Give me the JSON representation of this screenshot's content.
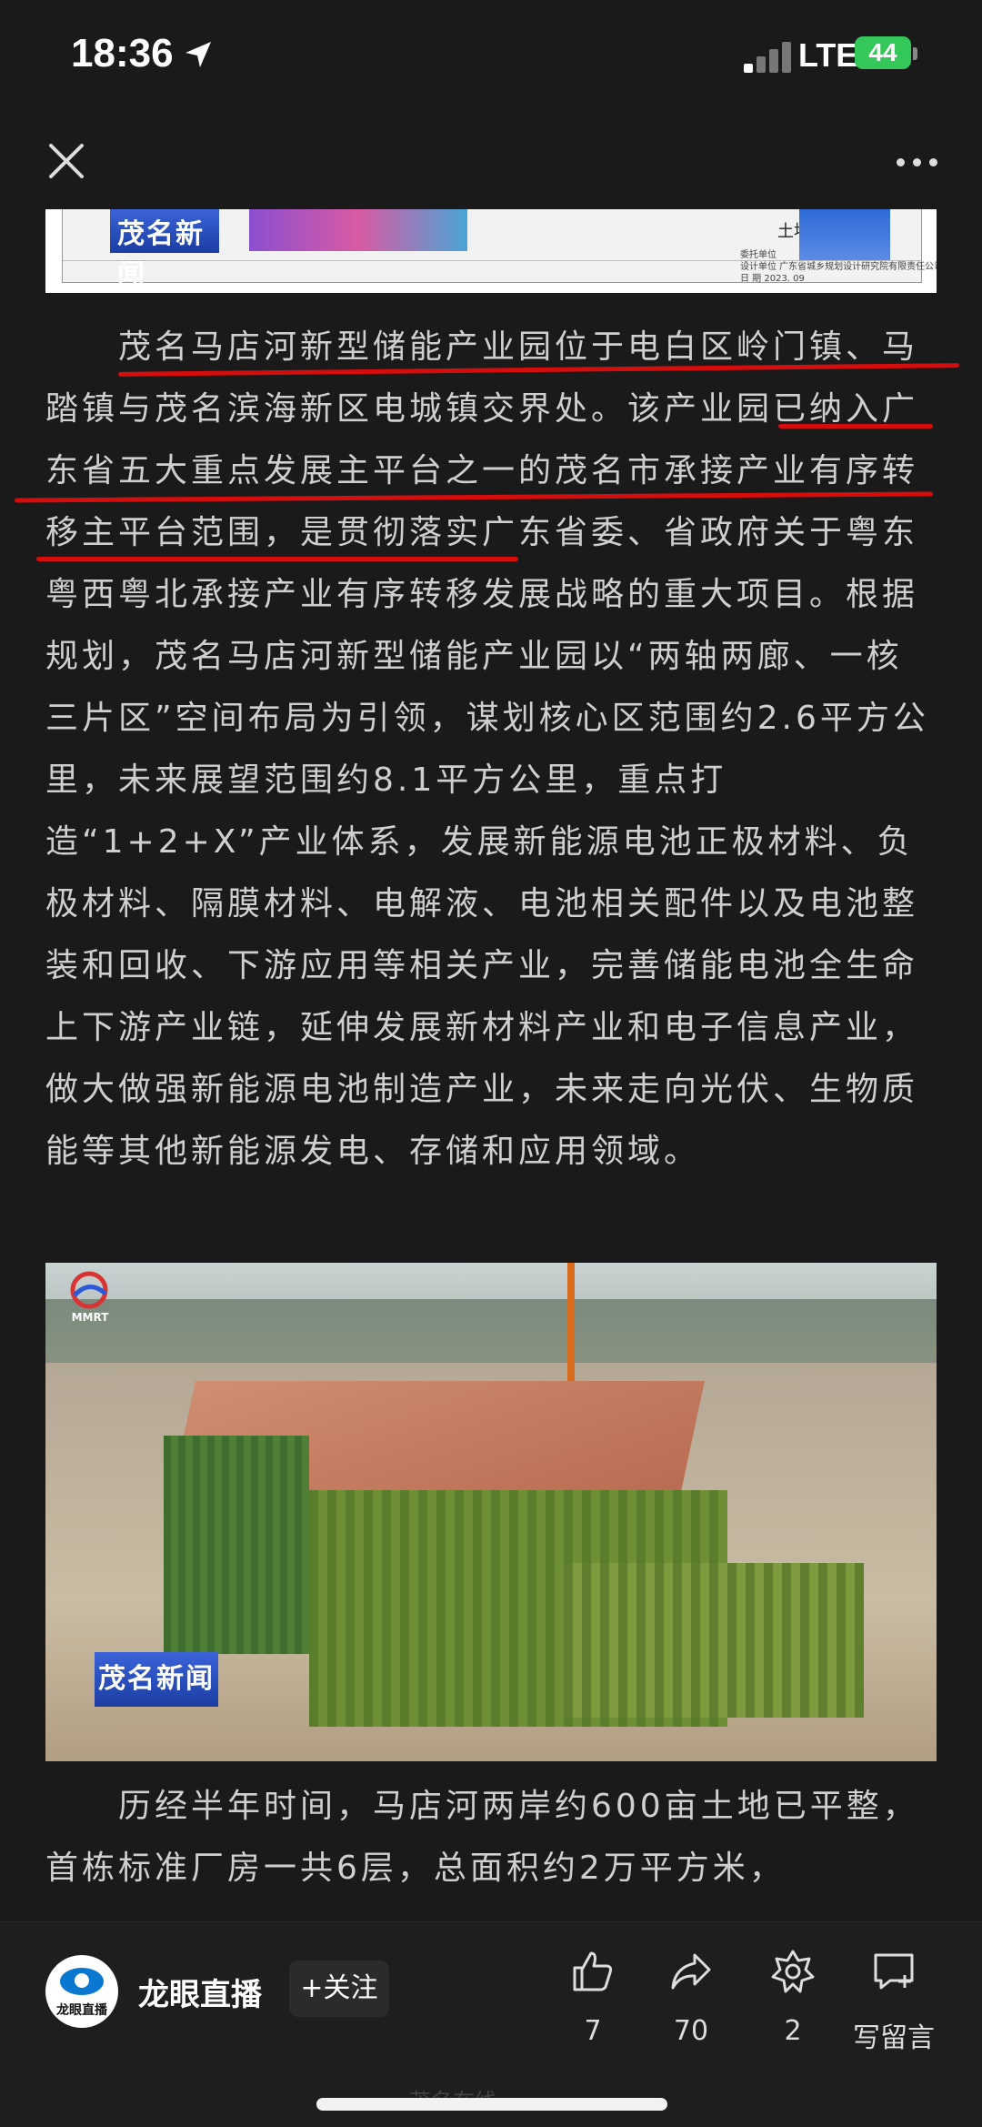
{
  "status_bar": {
    "time": "18:36",
    "network": "LTE",
    "battery": "44"
  },
  "map_image": {
    "logo_text": "茂名新闻",
    "label": "土地",
    "meta_lines": [
      "委托单位",
      "设计单位  广东省城乡规划设计研究院有限责任公司",
      "日 期          2023. 09"
    ]
  },
  "article": {
    "paragraph_1": "　　茂名马店河新型储能产业园位于电白区岭门镇、马踏镇与茂名滨海新区电城镇交界处。该产业园已纳入广东省五大重点发展主平台之一的茂名市承接产业有序转移主平台范围，是贯彻落实广东省委、省政府关于粤东粤西粤北承接产业有序转移发展战略的重大项目。根据规划，茂名马店河新型储能产业园以“两轴两廊、一核三片区”空间布局为引领，谋划核心区范围约2.6平方公里，未来展望范围约8.1平方公里，重点打造“1+2+X”产业体系，发展新能源电池正极材料、负极材料、隔膜材料、电解液、电池相关配件以及电池整装和回收、下游应用等相关产业，完善储能电池全生命上下游产业链，延伸发展新材料产业和电子信息产业，做大做强新能源电池制造产业，未来走向光伏、生物质能等其他新能源发电、存储和应用领域。",
    "paragraph_2": "　　历经半年时间，马店河两岸约600亩土地已平整，首栋标准厂房一共6层，总面积约2万平方米，"
  },
  "photo": {
    "logo_text": "MMRT",
    "badge_text": "茂名新闻"
  },
  "bottom_bar": {
    "account_name": "龙眼直播",
    "avatar_text": "龙眼直播",
    "follow_label": "+关注",
    "likes": "7",
    "shares": "70",
    "favorites": "2",
    "comment_label": "写留言"
  },
  "watermark": "茂名在线"
}
